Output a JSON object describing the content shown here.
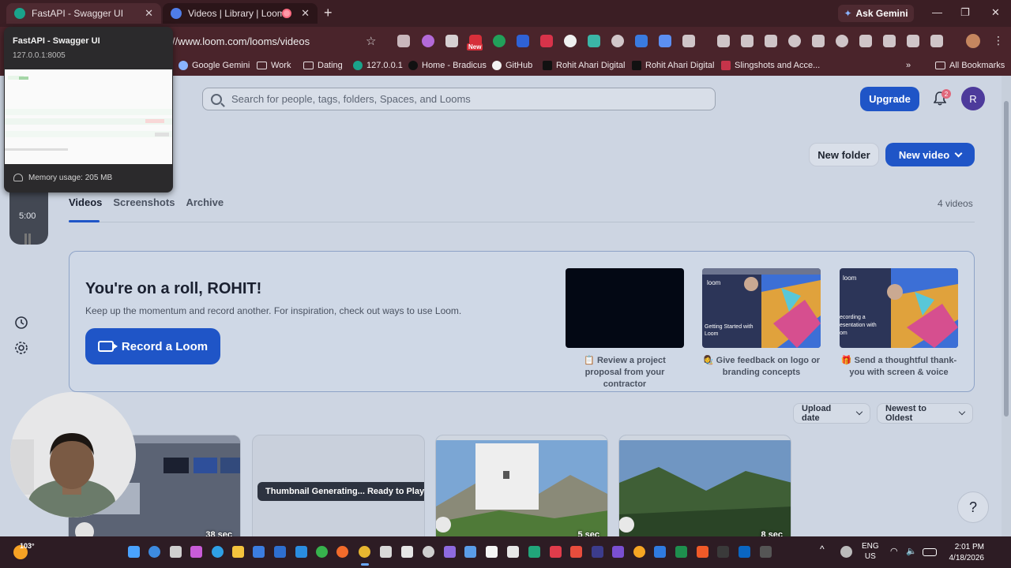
{
  "browser": {
    "tabs": [
      {
        "title": "FastAPI - Swagger UI",
        "active": true
      },
      {
        "title": "Videos | Library | Loom",
        "recording": true
      }
    ],
    "ask_gemini": "Ask Gemini",
    "url": "//www.loom.com/looms/videos",
    "new_badge": "New",
    "bookmarks": [
      "Google Gemini",
      "Work",
      "Dating",
      "127.0.0.1",
      "Home - Bradicus",
      "GitHub",
      "Rohit Ahari Digital",
      "Rohit Ahari Digital",
      "Slingshots and Acce..."
    ],
    "all_bookmarks": "All Bookmarks"
  },
  "hover_card": {
    "title": "FastAPI - Swagger UI",
    "url": "127.0.0.1:8005",
    "memory": "Memory usage: 205 MB"
  },
  "header": {
    "search_placeholder": "Search for people, tags, folders, Spaces, and Looms",
    "upgrade": "Upgrade",
    "notifications_count": "2",
    "avatar_initial": "R"
  },
  "actions": {
    "new_folder": "New folder",
    "new_video": "New video"
  },
  "library_tabs": [
    "Videos",
    "Screenshots",
    "Archive"
  ],
  "video_count": "4 videos",
  "recording_controls": {
    "timer": "5:00"
  },
  "banner": {
    "title": "You're on a roll, ROHIT!",
    "subtitle": "Keep up the momentum and record another. For inspiration, check out ways to use Loom.",
    "record_button": "Record a Loom",
    "ideas": [
      {
        "emoji": "📋",
        "caption": "Review a project proposal from your contractor"
      },
      {
        "emoji": "👩‍🎨",
        "caption": "Give feedback on logo or branding concepts",
        "thumb_text": "Getting Started with Loom",
        "thumb_brand": "loom"
      },
      {
        "emoji": "🎁",
        "caption": "Send a thoughtful thank-you with screen & voice",
        "thumb_text": "ecording a esentation with om",
        "thumb_brand": "loom"
      }
    ]
  },
  "sort": {
    "field": "Upload date",
    "order": "Newest to Oldest"
  },
  "videos": [
    {
      "duration": "38 sec"
    },
    {
      "status": "Thumbnail Generating... Ready to Play"
    },
    {
      "duration": "5 sec"
    },
    {
      "duration": "8 sec"
    }
  ],
  "help": "?",
  "taskbar": {
    "temperature": "103°",
    "language": [
      "ENG",
      "US"
    ],
    "time": "2:01 PM",
    "date": "4/18/2026"
  },
  "colors": {
    "accent": "#1f55c7",
    "tab_bar": "#3b1e24",
    "page_bg": "#cdd5e2"
  }
}
